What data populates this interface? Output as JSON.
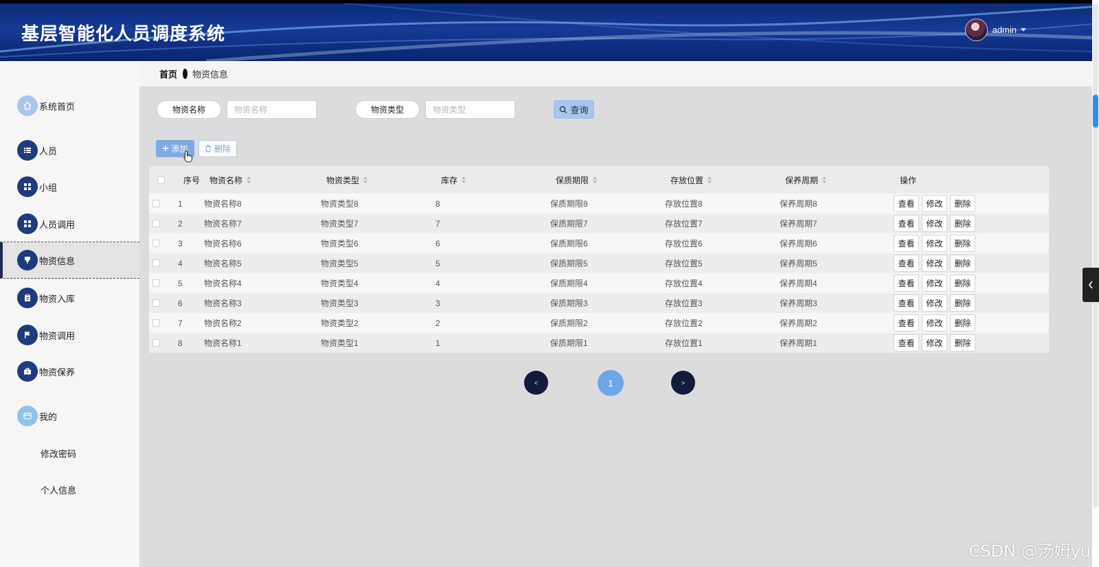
{
  "header": {
    "title": "基层智能化人员调度系统",
    "username": "admin",
    "icons": {
      "avatar": "user-avatar",
      "dropdown": "caret-down-icon"
    }
  },
  "breadcrumb": {
    "home": "首页",
    "current": "物资信息"
  },
  "sidebar": {
    "items": [
      {
        "label": "系统首页",
        "icon": "home-icon"
      },
      {
        "label": "人员",
        "icon": "list-icon"
      },
      {
        "label": "小组",
        "icon": "grid-icon"
      },
      {
        "label": "人员调用",
        "icon": "grid-icon"
      },
      {
        "label": "物资信息",
        "icon": "pin-icon",
        "active": true
      },
      {
        "label": "物资入库",
        "icon": "clipboard-icon"
      },
      {
        "label": "物资调用",
        "icon": "flag-icon"
      },
      {
        "label": "物资保养",
        "icon": "briefcase-icon"
      },
      {
        "label": "我的",
        "icon": "card-icon"
      }
    ],
    "sub_items": [
      {
        "label": "修改密码"
      },
      {
        "label": "个人信息"
      }
    ]
  },
  "search": {
    "name_label": "物资名称",
    "name_placeholder": "物资名称",
    "type_label": "物资类型",
    "type_placeholder": "物资类型",
    "query_label": "查询"
  },
  "toolbar": {
    "add_label": "添加",
    "delete_label": "删除"
  },
  "table": {
    "columns": [
      "序号",
      "物资名称",
      "物资类型",
      "库存",
      "保质期限",
      "存放位置",
      "保养周期",
      "操作"
    ],
    "rows": [
      {
        "no": "1",
        "name": "物资名称8",
        "type": "物资类型8",
        "stock": "8",
        "shelf": "保质期限8",
        "loc": "存放位置8",
        "cycle": "保养周期8"
      },
      {
        "no": "2",
        "name": "物资名称7",
        "type": "物资类型7",
        "stock": "7",
        "shelf": "保质期限7",
        "loc": "存放位置7",
        "cycle": "保养周期7"
      },
      {
        "no": "3",
        "name": "物资名称6",
        "type": "物资类型6",
        "stock": "6",
        "shelf": "保质期限6",
        "loc": "存放位置6",
        "cycle": "保养周期6"
      },
      {
        "no": "4",
        "name": "物资名称5",
        "type": "物资类型5",
        "stock": "5",
        "shelf": "保质期限5",
        "loc": "存放位置5",
        "cycle": "保养周期5"
      },
      {
        "no": "5",
        "name": "物资名称4",
        "type": "物资类型4",
        "stock": "4",
        "shelf": "保质期限4",
        "loc": "存放位置4",
        "cycle": "保养周期4"
      },
      {
        "no": "6",
        "name": "物资名称3",
        "type": "物资类型3",
        "stock": "3",
        "shelf": "保质期限3",
        "loc": "存放位置3",
        "cycle": "保养周期3"
      },
      {
        "no": "7",
        "name": "物资名称2",
        "type": "物资类型2",
        "stock": "2",
        "shelf": "保质期限2",
        "loc": "存放位置2",
        "cycle": "保养周期2"
      },
      {
        "no": "8",
        "name": "物资名称1",
        "type": "物资类型1",
        "stock": "1",
        "shelf": "保质期限1",
        "loc": "存放位置1",
        "cycle": "保养周期1"
      }
    ],
    "row_actions": {
      "view": "查看",
      "edit": "修改",
      "delete": "删除"
    }
  },
  "pagination": {
    "prev": "<",
    "current": "1",
    "next": ">"
  },
  "watermark": "CSDN @汤姆yu",
  "colors": {
    "header": "#163a96",
    "accent": "#6ea6e8",
    "sidebar_icon": "#1f3a7d"
  }
}
